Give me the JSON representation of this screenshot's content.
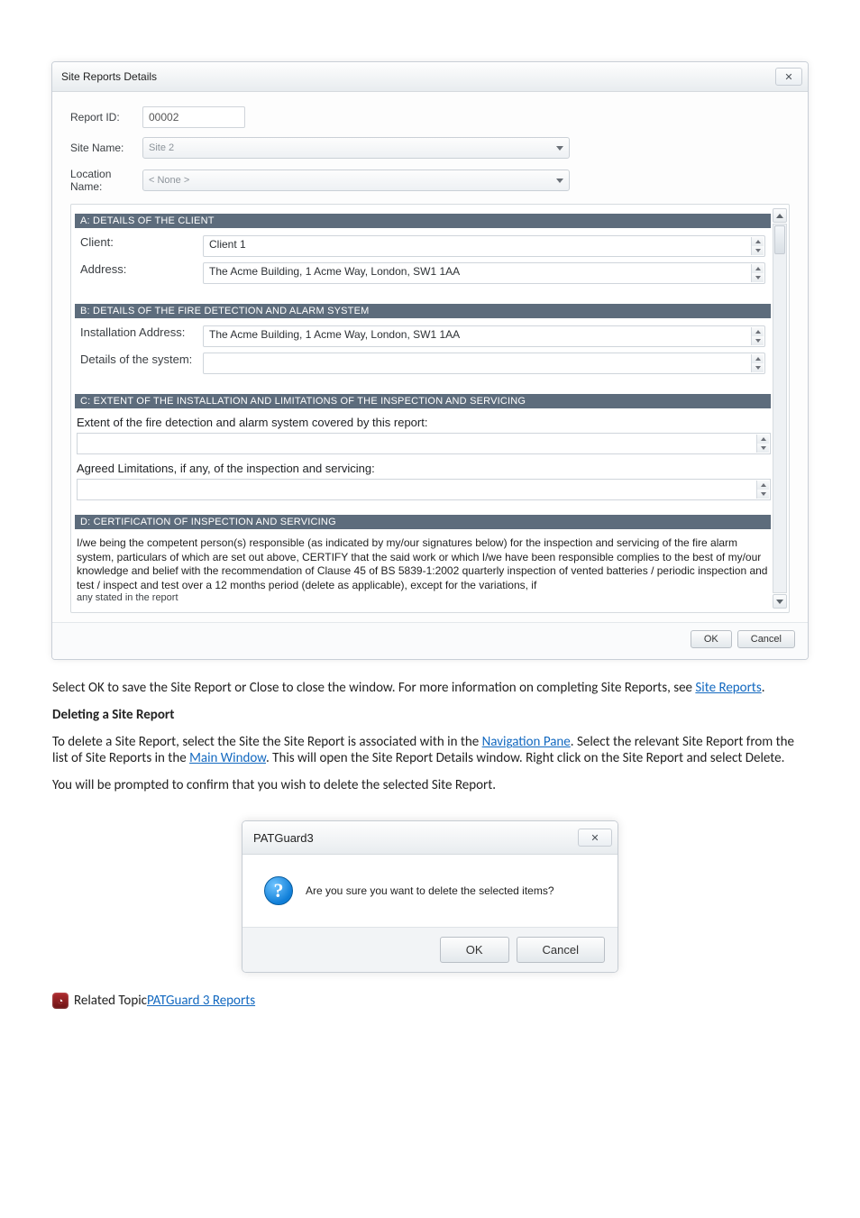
{
  "dialog": {
    "title": "Site Reports Details",
    "close_glyph": "✕",
    "top": {
      "report_id_label": "Report ID:",
      "report_id_value": "00002",
      "site_name_label": "Site Name:",
      "site_name_value": "Site 2",
      "location_name_label": "Location Name:",
      "location_name_value": "< None >"
    },
    "sections": {
      "a": {
        "bar": "A: DETAILS OF THE CLIENT",
        "client_label": "Client:",
        "client_value": "Client 1",
        "address_label": "Address:",
        "address_value": "The Acme Building, 1 Acme Way, London, SW1 1AA"
      },
      "b": {
        "bar": "B: DETAILS OF THE FIRE DETECTION AND ALARM SYSTEM",
        "install_label": "Installation Address:",
        "install_value": "The Acme Building, 1 Acme Way, London, SW1 1AA",
        "details_label": "Details of the system:",
        "details_value": ""
      },
      "c": {
        "bar": "C: EXTENT OF THE INSTALLATION AND LIMITATIONS OF THE INSPECTION AND SERVICING",
        "extent_lead": "Extent of the fire detection and alarm system covered by this report:",
        "limits_lead": "Agreed Limitations, if any, of the inspection and servicing:"
      },
      "d": {
        "bar": "D: CERTIFICATION OF INSPECTION AND SERVICING",
        "cert_text": "I/we being the competent person(s) responsible (as indicated by my/our signatures below) for the inspection and servicing of the fire alarm system, particulars of which are set out above, CERTIFY that the said work or which I/we have been responsible complies to the best of my/our knowledge and belief with the recommendation of Clause 45 of BS 5839-1:2002 quarterly inspection of vented batteries / periodic inspection and test / inspect and test over a 12 months period (delete as applicable), except for the variations, if",
        "truncated": "any  stated in the report"
      }
    },
    "footer": {
      "ok": "OK",
      "cancel": "Cancel"
    }
  },
  "doc": {
    "p1a": "Select OK to save the Site Report or Close to close the window. For more information on completing Site Reports, see ",
    "p1_link": "Site Reports",
    "p1b": ".",
    "h_delete": "Deleting a Site Report",
    "p2a": "To delete a Site Report, select the Site the Site Report is associated with in the ",
    "p2_link1": "Navigation Pane",
    "p2b": ". Select the relevant Site Report from the list of Site Reports in the ",
    "p2_link2": "Main Window",
    "p2c": ". This will open the Site Report Details window. Right click on the Site Report and select Delete.",
    "p3": "You will be prompted to confirm that you wish to delete the selected Site Report.",
    "related_label": " Related Topic  ",
    "related_link": "PATGuard 3 Reports"
  },
  "confirm": {
    "title": "PATGuard3",
    "close_glyph": "✕",
    "msg": "Are you sure you want to delete the selected items?",
    "ok": "OK",
    "cancel": "Cancel"
  }
}
